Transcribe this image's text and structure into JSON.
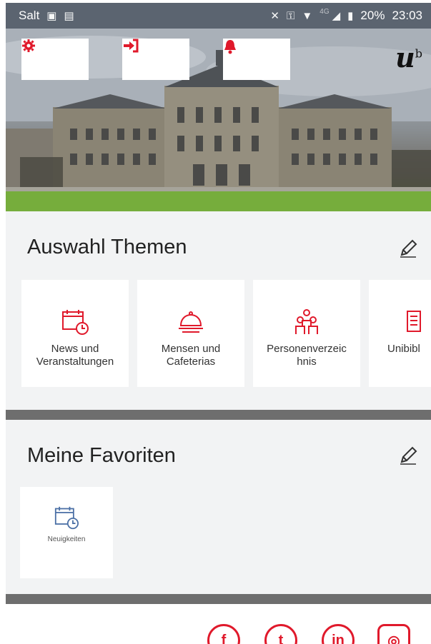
{
  "status_bar": {
    "carrier": "Salt",
    "network": "4G",
    "battery": "20%",
    "time": "23:03"
  },
  "hero": {
    "logo_letter": "u",
    "logo_sup": "b",
    "buttons": [
      {
        "icon": "gear-icon"
      },
      {
        "icon": "sign-in-icon"
      },
      {
        "icon": "bell-icon"
      }
    ]
  },
  "themes": {
    "title": "Auswahl Themen",
    "tiles": [
      {
        "icon": "calendar-clock-icon",
        "line1": "News und",
        "line2": "Veranstaltungen"
      },
      {
        "icon": "cloche-icon",
        "line1": "Mensen und",
        "line2": "Cafeterias"
      },
      {
        "icon": "people-directory-icon",
        "line1": "Personenverzeic",
        "line2": "hnis"
      },
      {
        "icon": "book-icon",
        "line1": "Unibibl",
        "line2": ""
      }
    ]
  },
  "favorites": {
    "title": "Meine Favoriten",
    "items": [
      {
        "icon": "calendar-clock-icon",
        "label": "Neuigkeiten"
      }
    ]
  },
  "social": {
    "items": [
      {
        "name": "facebook-icon",
        "glyph": "f"
      },
      {
        "name": "twitter-icon",
        "glyph": "t"
      },
      {
        "name": "linkedin-icon",
        "glyph": "in"
      },
      {
        "name": "instagram-icon",
        "glyph": "◎"
      }
    ]
  },
  "colors": {
    "accent": "#e0192b",
    "status_bar": "#5b6470",
    "section_bg": "#f2f3f4",
    "divider": "#6e6e6e",
    "favorite_icon": "#4a6fa5"
  }
}
